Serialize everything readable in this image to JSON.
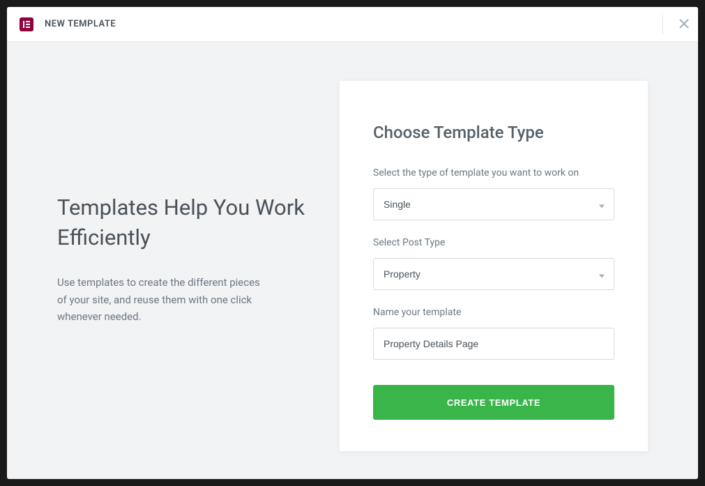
{
  "header": {
    "title": "NEW TEMPLATE"
  },
  "marketing": {
    "title": "Templates Help You Work Efficiently",
    "description": "Use templates to create the different pieces of your site, and reuse them with one click whenever needed."
  },
  "form": {
    "heading": "Choose Template Type",
    "template_type": {
      "label": "Select the type of template you want to work on",
      "value": "Single"
    },
    "post_type": {
      "label": "Select Post Type",
      "value": "Property"
    },
    "template_name": {
      "label": "Name your template",
      "value": "Property Details Page"
    },
    "submit_label": "CREATE TEMPLATE"
  }
}
